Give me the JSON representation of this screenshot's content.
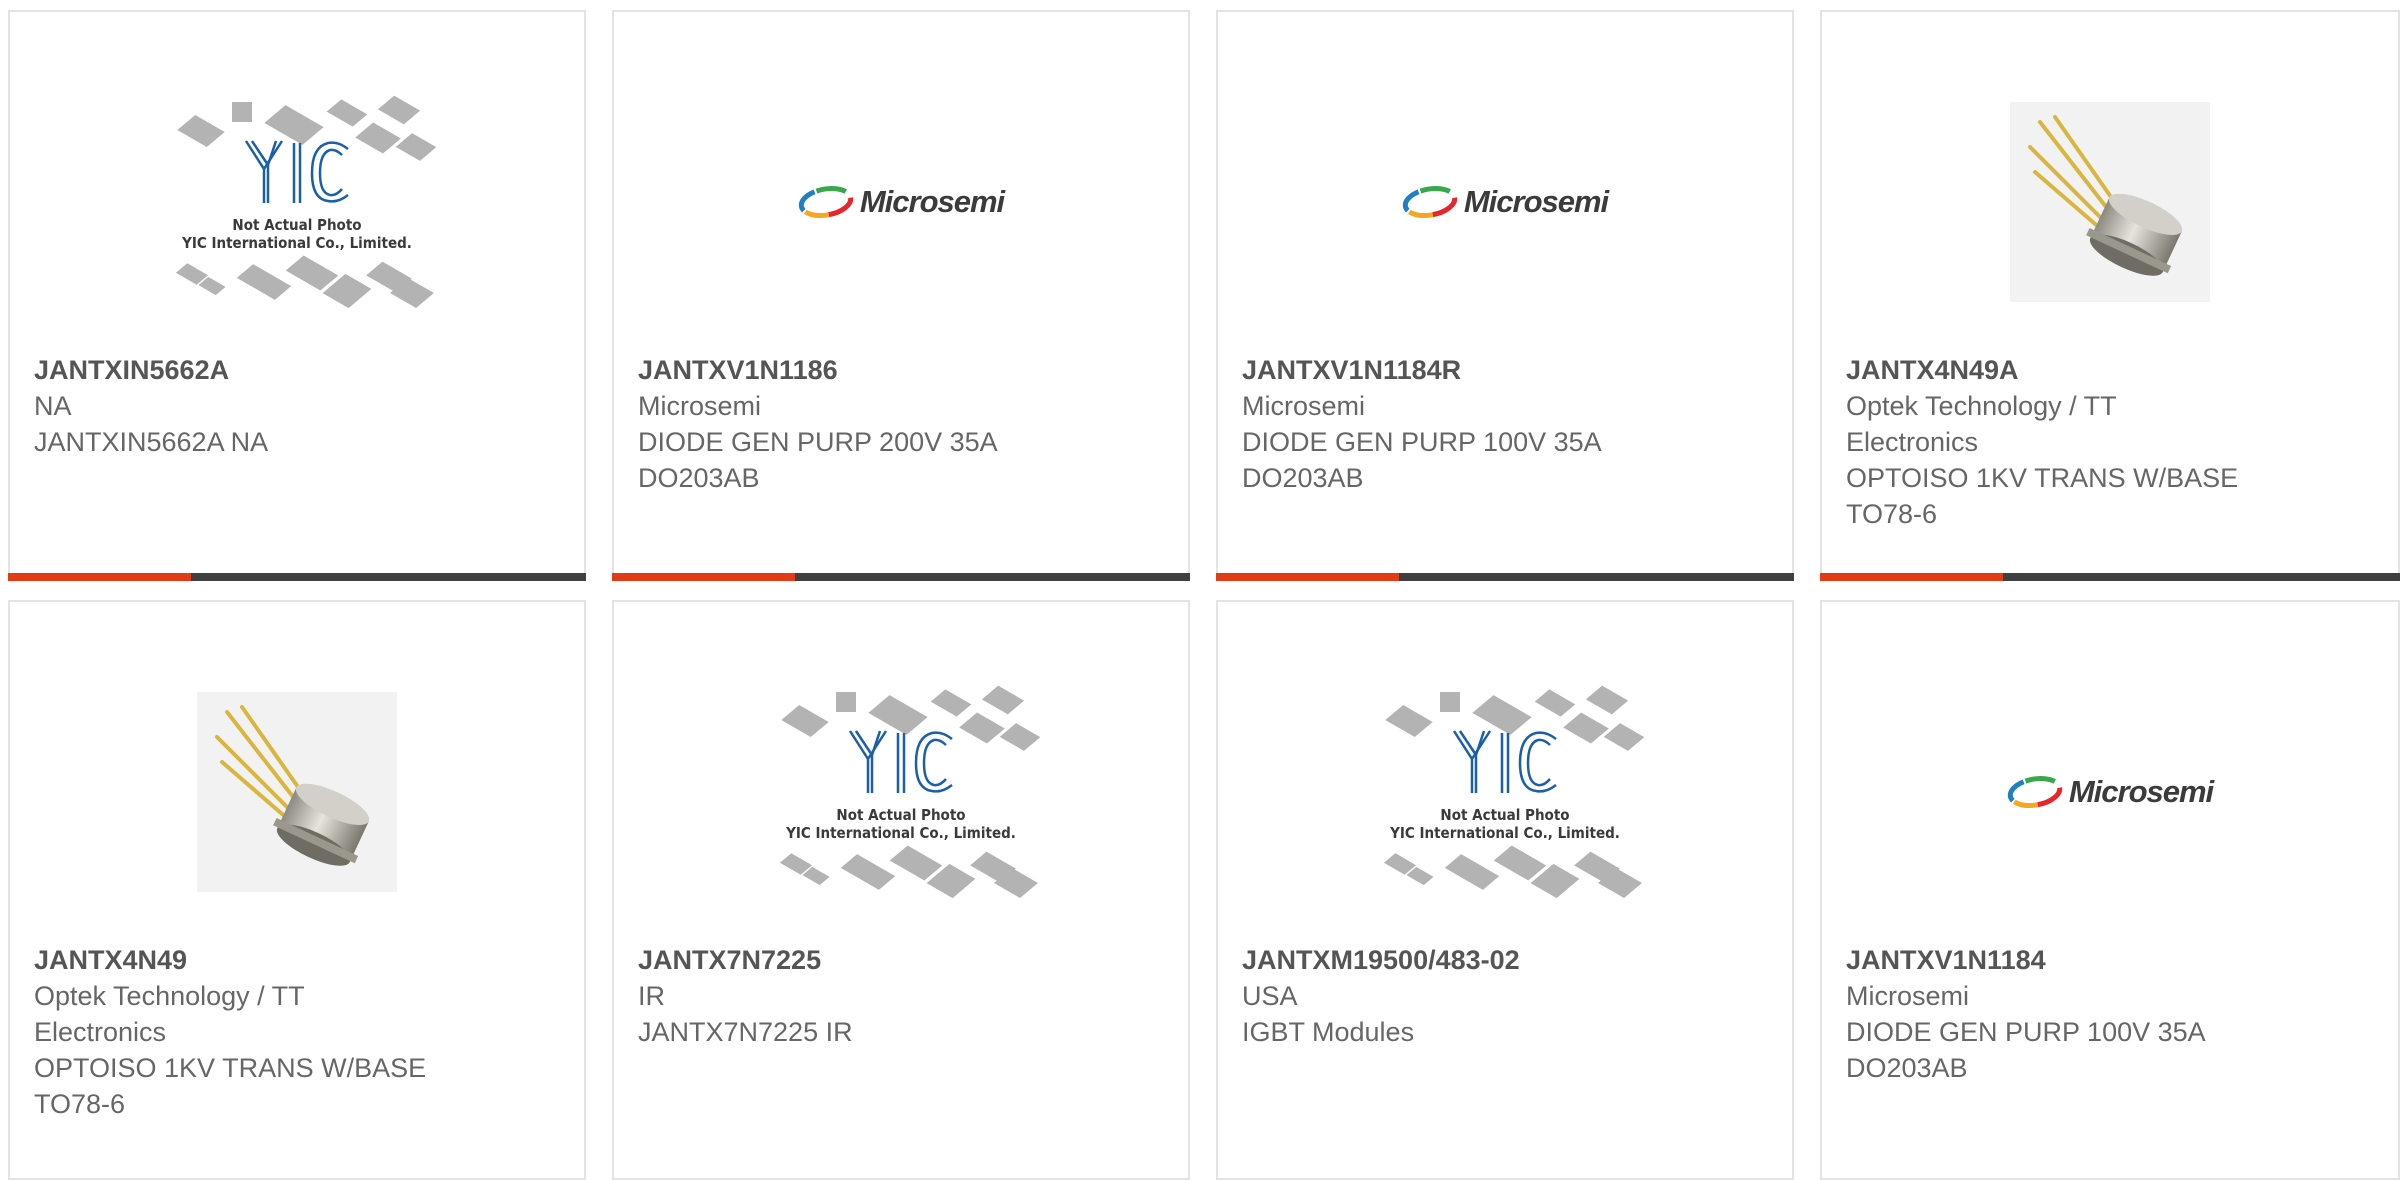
{
  "placeholder": {
    "line1": "Not Actual Photo",
    "line2": "YIC International Co., Limited."
  },
  "brand_logo": "Microsemi",
  "colors": {
    "accent": "#e23c17",
    "bar": "#3f3f3f",
    "text": "#666666",
    "title": "#555555"
  },
  "products": [
    {
      "part": "JANTXIN5662A",
      "lines": [
        "NA",
        "JANTXIN5662A NA"
      ],
      "image": "yic-placeholder"
    },
    {
      "part": "JANTXV1N1186",
      "lines": [
        "Microsemi",
        "DIODE GEN PURP 200V 35A",
        "DO203AB"
      ],
      "image": "microsemi-logo"
    },
    {
      "part": "JANTXV1N1184R",
      "lines": [
        "Microsemi",
        "DIODE GEN PURP 100V 35A",
        "DO203AB"
      ],
      "image": "microsemi-logo"
    },
    {
      "part": "JANTX4N49A",
      "lines": [
        "Optek Technology / TT",
        "Electronics",
        "OPTOISO 1KV TRANS W/BASE",
        "TO78-6"
      ],
      "image": "transistor-photo"
    },
    {
      "part": "JANTX4N49",
      "lines": [
        "Optek Technology / TT",
        "Electronics",
        "OPTOISO 1KV TRANS W/BASE",
        "TO78-6"
      ],
      "image": "transistor-photo"
    },
    {
      "part": "JANTX7N7225",
      "lines": [
        "IR",
        "JANTX7N7225 IR"
      ],
      "image": "yic-placeholder"
    },
    {
      "part": "JANTXM19500/483-02",
      "lines": [
        "USA",
        "IGBT Modules"
      ],
      "image": "yic-placeholder"
    },
    {
      "part": "JANTXV1N1184",
      "lines": [
        "Microsemi",
        "DIODE GEN PURP 100V 35A",
        "DO203AB"
      ],
      "image": "microsemi-logo"
    }
  ]
}
